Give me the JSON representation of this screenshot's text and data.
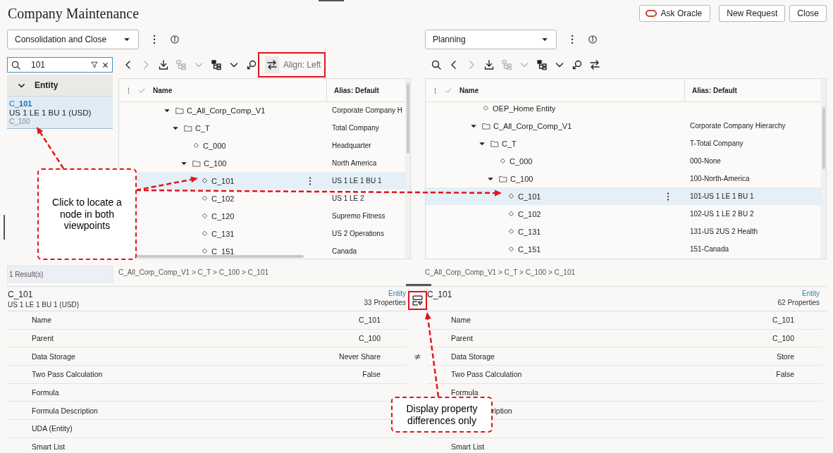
{
  "title": "Company Maintenance",
  "header_buttons": [
    {
      "kind": "ask",
      "label": "Ask Oracle"
    },
    {
      "kind": "plain",
      "label": "New Request"
    },
    {
      "kind": "plain",
      "label": "Close"
    }
  ],
  "viewpoints": [
    {
      "application": "Consolidation and Close",
      "search": {
        "value": "101",
        "group": "Entity",
        "group_expanded": true,
        "results": [
          {
            "name": "C_**101**",
            "alias": "US 1 LE 1 BU 1 (USD)",
            "parent": "C_100",
            "selected": true
          }
        ],
        "count": "1 Result(s)"
      },
      "toolbar": [
        {
          "kind": "back",
          "disabled": false
        },
        {
          "kind": "forward",
          "disabled": true
        },
        {
          "kind": "download",
          "disabled": false
        },
        {
          "kind": "hierarchy",
          "disabled": true
        },
        {
          "kind": "hierarchy-menu",
          "disabled": true
        },
        {
          "kind": "tree",
          "disabled": false
        },
        {
          "kind": "tree-menu",
          "disabled": false
        },
        {
          "kind": "locate",
          "disabled": false
        },
        {
          "kind": "align",
          "disabled": false,
          "label": "Align: Left"
        }
      ],
      "columns": [
        "Name",
        "Alias: Default"
      ],
      "nodes": [
        {
          "kind": "folder",
          "name": "C_All_Corp_Comp_V1",
          "alias": "Corporate Company H",
          "expanded": true,
          "selected": false,
          "children": [
            {
              "kind": "folder",
              "name": "C_T",
              "alias": "Total Company",
              "expanded": true,
              "selected": false,
              "children": [
                {
                  "kind": "leaf",
                  "name": "C_000",
                  "alias": "Headquarter",
                  "selected": false
                },
                {
                  "kind": "folder",
                  "name": "C_100",
                  "alias": "North America",
                  "expanded": true,
                  "selected": false,
                  "children": [
                    {
                      "kind": "leaf",
                      "name": "C_101",
                      "alias": "US 1 LE 1 BU 1",
                      "selected": true
                    },
                    {
                      "kind": "leaf",
                      "name": "C_102",
                      "alias": "US 1 LE 2",
                      "selected": false
                    },
                    {
                      "kind": "leaf",
                      "name": "C_120",
                      "alias": "Supremo Fitness",
                      "selected": false
                    },
                    {
                      "kind": "leaf",
                      "name": "C_131",
                      "alias": "US 2 Operations",
                      "selected": false
                    },
                    {
                      "kind": "leaf",
                      "name": "C_151",
                      "alias": "Canada",
                      "selected": false
                    }
                  ]
                }
              ]
            }
          ]
        }
      ],
      "breadcrumb": "C_All_Corp_Comp_V1 > C_T > C_100 > C_101"
    },
    {
      "application": "Planning",
      "toolbar": [
        {
          "kind": "search",
          "disabled": false
        },
        {
          "kind": "back",
          "disabled": false
        },
        {
          "kind": "forward",
          "disabled": true
        },
        {
          "kind": "download",
          "disabled": false
        },
        {
          "kind": "hierarchy",
          "disabled": true
        },
        {
          "kind": "hierarchy-menu",
          "disabled": true
        },
        {
          "kind": "tree",
          "disabled": false
        },
        {
          "kind": "tree-menu",
          "disabled": false
        },
        {
          "kind": "locate",
          "disabled": false
        },
        {
          "kind": "align",
          "disabled": false
        }
      ],
      "columns": [
        "Name",
        "Alias: Default"
      ],
      "nodes": [
        {
          "kind": "leaf",
          "name": "OEP_Home Entity",
          "selected": false
        },
        {
          "kind": "folder",
          "name": "C_All_Corp_Comp_V1",
          "alias": "Corporate Company Hierarchy",
          "expanded": true,
          "selected": false,
          "children": [
            {
              "kind": "folder",
              "name": "C_T",
              "alias": "T-Total Company",
              "expanded": true,
              "selected": false,
              "children": [
                {
                  "kind": "leaf",
                  "name": "C_000",
                  "alias": "000-None",
                  "selected": false
                },
                {
                  "kind": "folder",
                  "name": "C_100",
                  "alias": "100-North-America",
                  "expanded": true,
                  "selected": false,
                  "children": [
                    {
                      "kind": "leaf",
                      "name": "C_101",
                      "alias": "101-US 1 LE 1 BU 1",
                      "selected": true
                    },
                    {
                      "kind": "leaf",
                      "name": "C_102",
                      "alias": "102-US 1 LE 2 BU 2",
                      "selected": false
                    },
                    {
                      "kind": "leaf",
                      "name": "C_131",
                      "alias": "131-US 2US 2 Health",
                      "selected": false
                    },
                    {
                      "kind": "leaf",
                      "name": "C_151",
                      "alias": "151-Canada",
                      "selected": false
                    }
                  ]
                }
              ]
            }
          ]
        }
      ],
      "breadcrumb": "C_All_Corp_Comp_V1 > C_T > C_100 > C_101"
    }
  ],
  "properties": {
    "left": {
      "name": "C_101",
      "alias": "US 1 LE 1 BU 1 (USD)",
      "type": "Entity",
      "count": "33 Properties"
    },
    "right": {
      "name": "C_101",
      "type": "Entity",
      "count": "62 Properties"
    },
    "rows": [
      {
        "left": {
          "label": "Name",
          "value": "C_101"
        },
        "right": {
          "label": "Name",
          "value": "C_101",
          "partly_covered": false
        },
        "differs": false
      },
      {
        "left": {
          "label": "Parent",
          "value": "C_100"
        },
        "right": {
          "label": "Parent",
          "value": "C_100",
          "partly_covered": false
        },
        "differs": false
      },
      {
        "left": {
          "label": "Data Storage",
          "value": "Never Share"
        },
        "right": {
          "label": "Data Storage",
          "value": "Store",
          "partly_covered": false
        },
        "differs": true
      },
      {
        "left": {
          "label": "Two Pass Calculation",
          "value": "False"
        },
        "right": {
          "label": "Two Pass Calculation",
          "value": "False",
          "partly_covered": false
        },
        "differs": false
      },
      {
        "left": {
          "label": "Formula"
        },
        "right": {
          "label": "Formula",
          "partly_covered": false
        },
        "differs": false
      },
      {
        "left": {
          "label": "Formula Description"
        },
        "right": {
          "label": "ription",
          "partly_covered": true
        },
        "differs": false
      },
      {
        "left": {
          "label": "UDA (Entity)"
        }
      },
      {
        "left": {
          "label": "Smart List"
        },
        "right": {
          "label": "Smart List",
          "partly_covered": false
        },
        "differs": false
      }
    ]
  },
  "callouts": [
    {
      "text": "Click to locate a node in both viewpoints"
    },
    {
      "text": "Display property differences only"
    }
  ]
}
